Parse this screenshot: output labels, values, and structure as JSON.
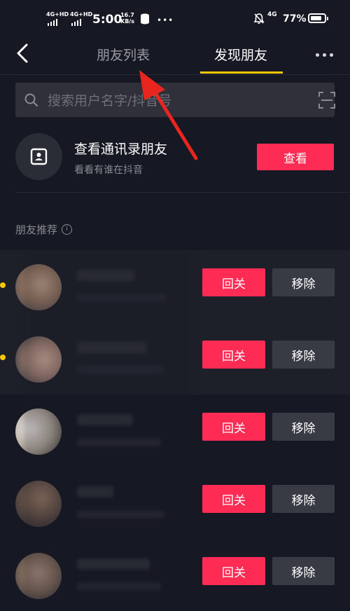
{
  "status_bar": {
    "network1": "4G+HD",
    "network2": "4G+HD",
    "time": "5:00",
    "speed_value": "16.7",
    "speed_unit": "KB/s",
    "lte": "4G",
    "battery": "77%"
  },
  "nav": {
    "tab_friends_list": "朋友列表",
    "tab_discover": "发现朋友"
  },
  "search": {
    "placeholder": "搜索用户名字/抖音号"
  },
  "contacts": {
    "title": "查看通讯录朋友",
    "subtitle": "看看有谁在抖音",
    "button": "查看"
  },
  "recommend": {
    "section_title": "朋友推荐",
    "info": "i",
    "items": [
      {
        "follow_label": "回关",
        "remove_label": "移除",
        "highlight": true,
        "unread_dot": true
      },
      {
        "follow_label": "回关",
        "remove_label": "移除",
        "highlight": true,
        "unread_dot": true
      },
      {
        "follow_label": "回关",
        "remove_label": "移除",
        "highlight": false,
        "unread_dot": false
      },
      {
        "follow_label": "回关",
        "remove_label": "移除",
        "highlight": false,
        "unread_dot": false
      },
      {
        "follow_label": "回关",
        "remove_label": "移除",
        "highlight": false,
        "unread_dot": false
      }
    ]
  },
  "colors": {
    "background": "#161823",
    "accent": "#fe2c55",
    "tab_indicator": "#f7c700",
    "annotation_arrow": "#e8261f"
  },
  "icons": {
    "back": "chevron-left-icon",
    "more": "more-dots-icon",
    "search": "search-icon",
    "scan": "scan-icon",
    "contacts": "contacts-book-icon",
    "info": "info-icon"
  }
}
